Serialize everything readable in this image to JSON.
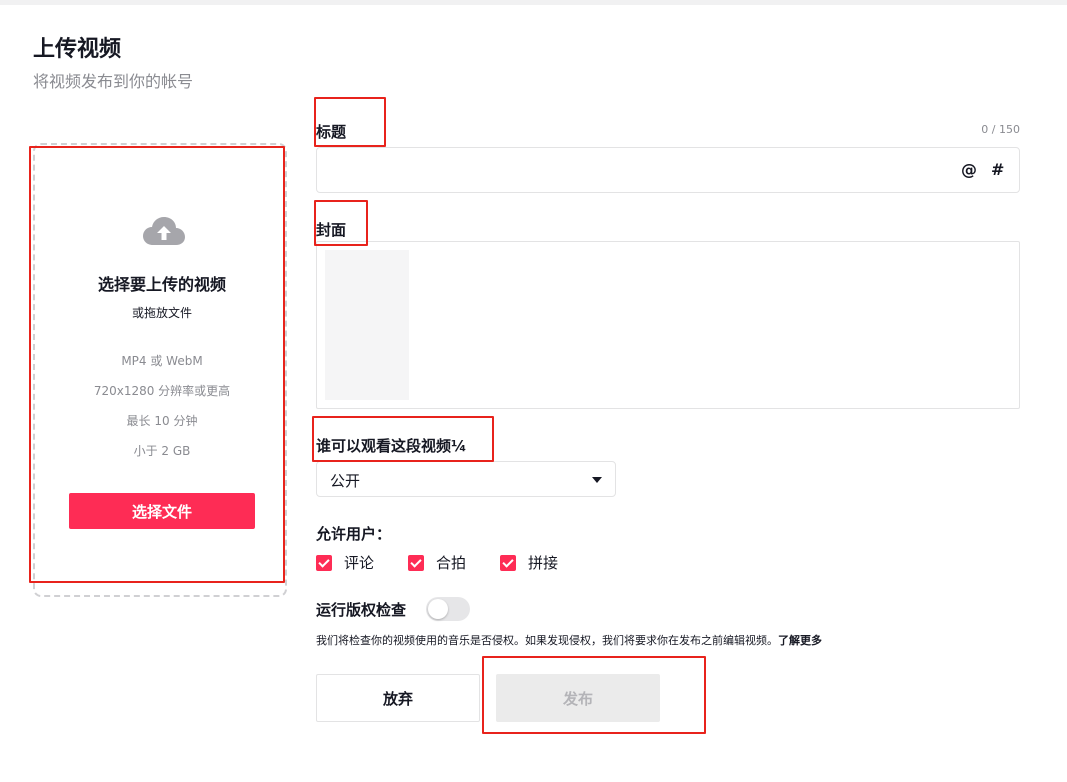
{
  "header": {
    "title": "上传视频",
    "subtitle": "将视频发布到你的帐号"
  },
  "upload": {
    "icon": "cloud-upload-icon",
    "title": "选择要上传的视频",
    "subtitle": "或拖放文件",
    "requirements": [
      "MP4 或 WebM",
      "720x1280 分辨率或更高",
      "最长 10 分钟",
      "小于 2 GB"
    ],
    "button_label": "选择文件"
  },
  "form": {
    "title_label": "标题",
    "char_count": "0 / 150",
    "title_value": "",
    "mention_symbol": "@",
    "hashtag_symbol": "#",
    "cover_label": "封面",
    "privacy_label": "谁可以观看这段视频¼",
    "privacy_value": "公开",
    "allow_label": "允许用户：",
    "allow_options": [
      {
        "label": "评论",
        "checked": true
      },
      {
        "label": "合拍",
        "checked": true
      },
      {
        "label": "拼接",
        "checked": true
      }
    ],
    "copyright_label": "运行版权检查",
    "copyright_enabled": false,
    "copyright_desc": "我们将检查你的视频使用的音乐是否侵权。如果发现侵权，我们将要求你在发布之前编辑视频。",
    "learn_more": "了解更多",
    "discard_label": "放弃",
    "publish_label": "发布"
  },
  "colors": {
    "accent": "#fe2c55",
    "annotation": "#e8231c",
    "muted_text": "#8a8b91",
    "disabled_button": "#ebebeb"
  }
}
